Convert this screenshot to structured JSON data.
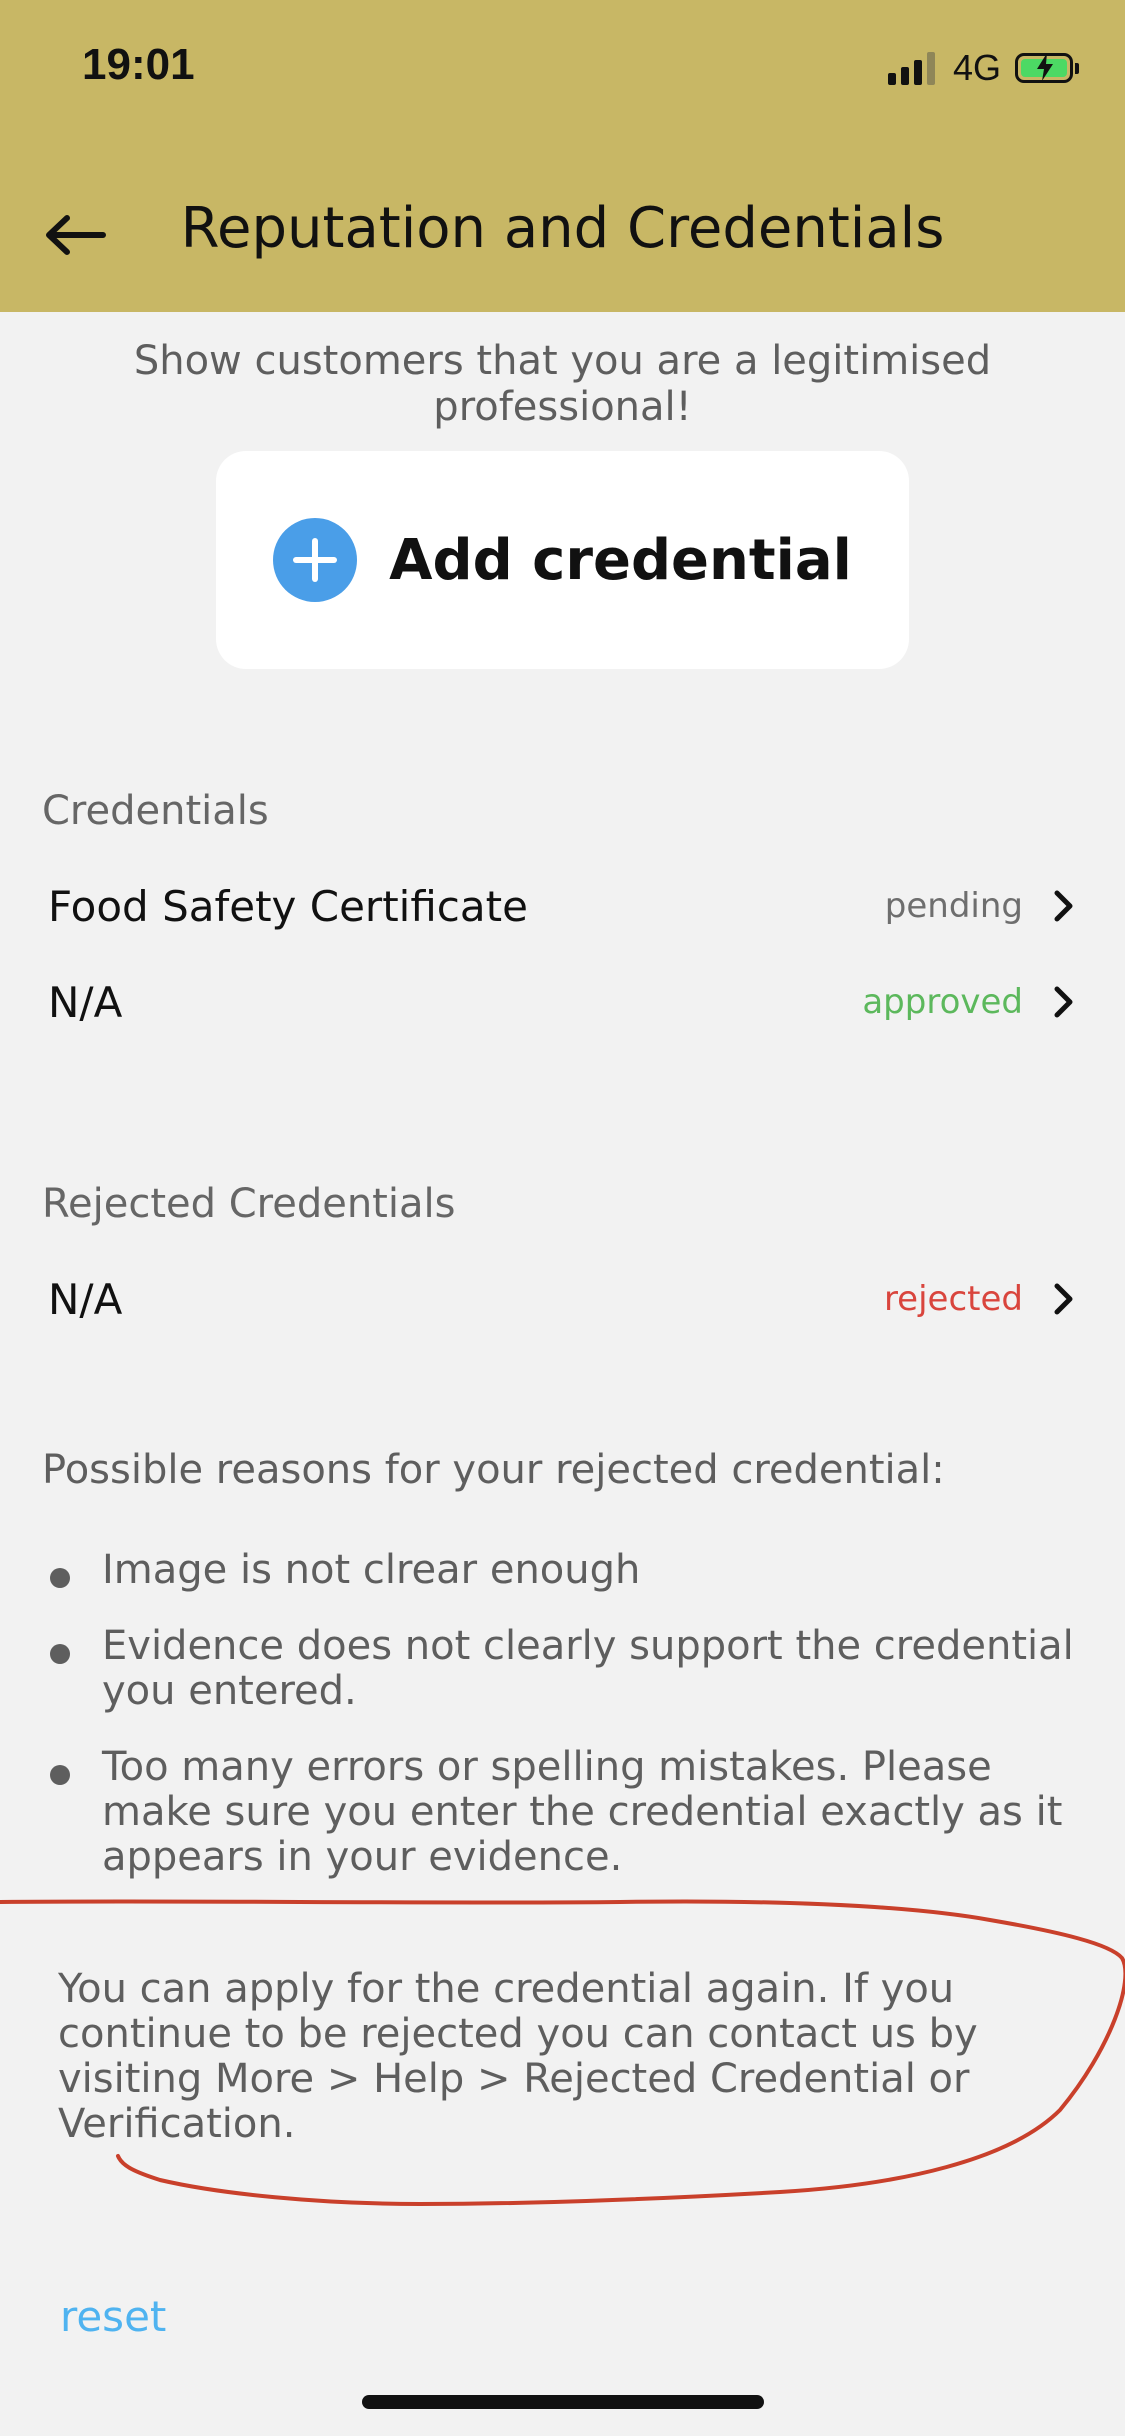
{
  "status_bar": {
    "time": "19:01",
    "network": "4G"
  },
  "header": {
    "title": "Reputation and Credentials"
  },
  "subtitle": "Show customers that you are a legitimised professional!",
  "add_button": {
    "label": "Add credential"
  },
  "credentials": {
    "heading": "Credentials",
    "items": [
      {
        "title": "Food Safety Certificate",
        "status": "pending"
      },
      {
        "title": "N/A",
        "status": "approved"
      }
    ]
  },
  "rejected": {
    "heading": "Rejected Credentials",
    "items": [
      {
        "title": "N/A",
        "status": "rejected"
      }
    ]
  },
  "reasons": {
    "heading": "Possible reasons for your rejected credential:",
    "items": [
      "Image is not clrear enough",
      "Evidence does not clearly support the credential you entered.",
      "Too many errors or spelling mistakes. Please make sure you enter the credential exactly as it appears in your evidence."
    ]
  },
  "footer_note": "You can apply for the credential again. If you continue to be rejected you can contact us by visiting More > Help > Rejected Credential or Verification.",
  "reset_label": "reset",
  "colors": {
    "header_bg": "#c8b765",
    "accent_blue": "#4a9ee8",
    "status_pending": "#6e6e6e",
    "status_approved": "#5cb85c",
    "status_rejected": "#d9453d",
    "annotation": "#c9402b",
    "link": "#4fb3f0"
  }
}
